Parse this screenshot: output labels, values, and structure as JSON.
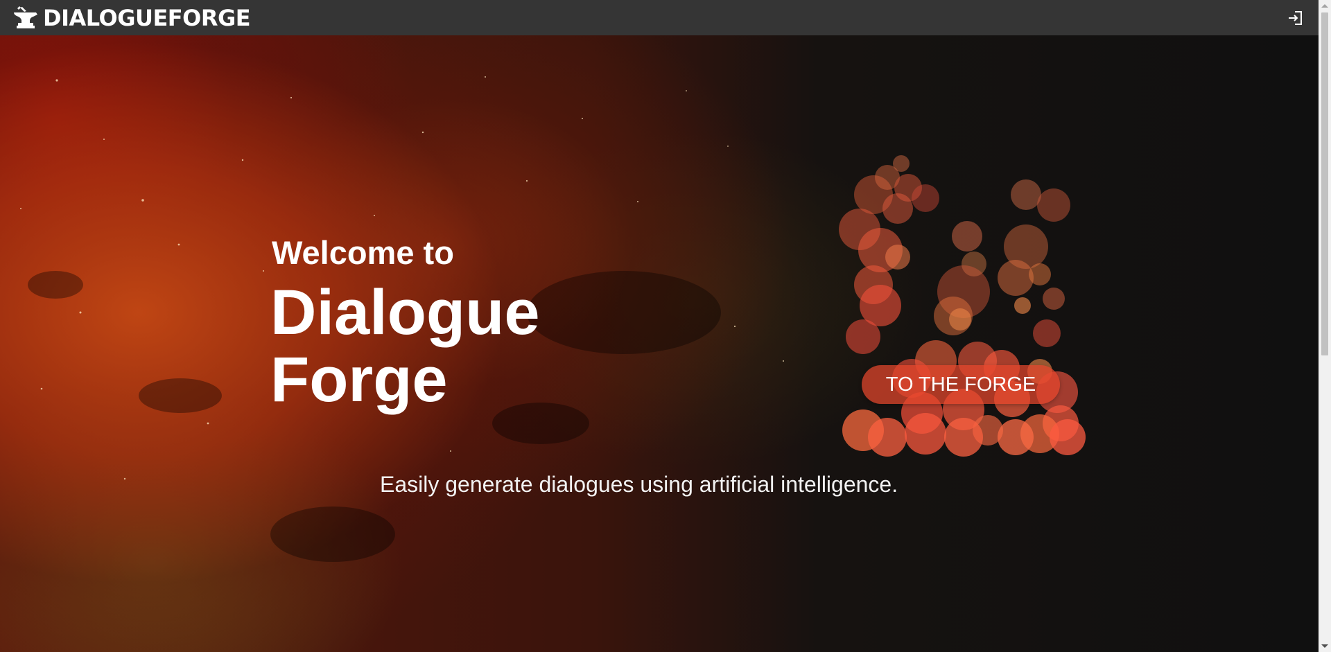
{
  "header": {
    "logo_text": "DIALOGUEFORGE",
    "logo_icon": "anvil-icon",
    "login_icon": "sign-in-icon"
  },
  "hero": {
    "welcome": "Welcome to",
    "title_line1": "Dialogue",
    "title_line2": "Forge",
    "cta_label": "TO THE FORGE",
    "subtitle": "Easily generate dialogues using artificial intelligence."
  },
  "colors": {
    "topbar_bg": "#353535",
    "cta_bg": "#e6462d",
    "text": "#ffffff",
    "bubble_warm": "#ff5a36"
  }
}
